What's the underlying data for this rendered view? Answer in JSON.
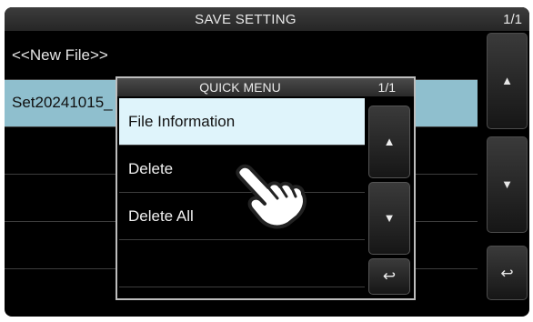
{
  "header": {
    "title": "SAVE SETTING",
    "page": "1/1"
  },
  "file_list": [
    {
      "label": "<<New File>>"
    },
    {
      "label": "Set20241015_"
    },
    {
      "label": ""
    },
    {
      "label": ""
    },
    {
      "label": ""
    }
  ],
  "side_buttons": {
    "up_icon": "▲",
    "down_icon": "▼",
    "back_icon": "↩"
  },
  "quick_menu": {
    "title": "QUICK MENU",
    "page": "1/1",
    "items": [
      {
        "label": "File Information"
      },
      {
        "label": "Delete"
      },
      {
        "label": "Delete All"
      },
      {
        "label": ""
      }
    ],
    "up_icon": "▲",
    "down_icon": "▼",
    "back_icon": "↩"
  },
  "colors": {
    "highlight_row": "#8fbfce",
    "highlight_menu_item": "#dff4fb"
  }
}
